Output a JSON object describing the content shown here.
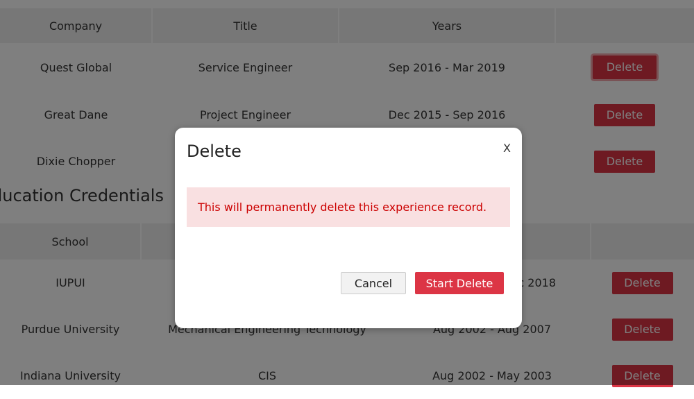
{
  "experience": {
    "headers": [
      "Company",
      "Title",
      "Years",
      ""
    ],
    "rows": [
      {
        "company": "Quest Global",
        "title": "Service Engineer",
        "years": "Sep 2016 - Mar 2019",
        "action": "Delete"
      },
      {
        "company": "Great Dane",
        "title": "Project Engineer",
        "years": "Dec 2015 - Sep 2016",
        "action": "Delete"
      },
      {
        "company": "Dixie Chopper",
        "title": "",
        "years": "",
        "action": "Delete"
      }
    ]
  },
  "education": {
    "section_title": "ducation Credentials",
    "headers": [
      "School",
      "",
      "",
      ""
    ],
    "rows": [
      {
        "school": "IUPUI",
        "field": "",
        "years": "c 2018",
        "action": "Delete"
      },
      {
        "school": "Purdue University",
        "field": "Mechanical Engineering Technology",
        "years": "Aug 2002 - Aug 2007",
        "action": "Delete"
      },
      {
        "school": "Indiana University",
        "field": "CIS",
        "years": "Aug 2002 - May 2003",
        "action": "Delete"
      }
    ]
  },
  "modal": {
    "title": "Delete",
    "close_label": "X",
    "message": "This will permanently delete this experience record.",
    "cancel_label": "Cancel",
    "confirm_label": "Start Delete"
  },
  "colors": {
    "danger": "#dc3545",
    "alert_bg": "#f9e0e1",
    "alert_text": "#cc0000"
  }
}
